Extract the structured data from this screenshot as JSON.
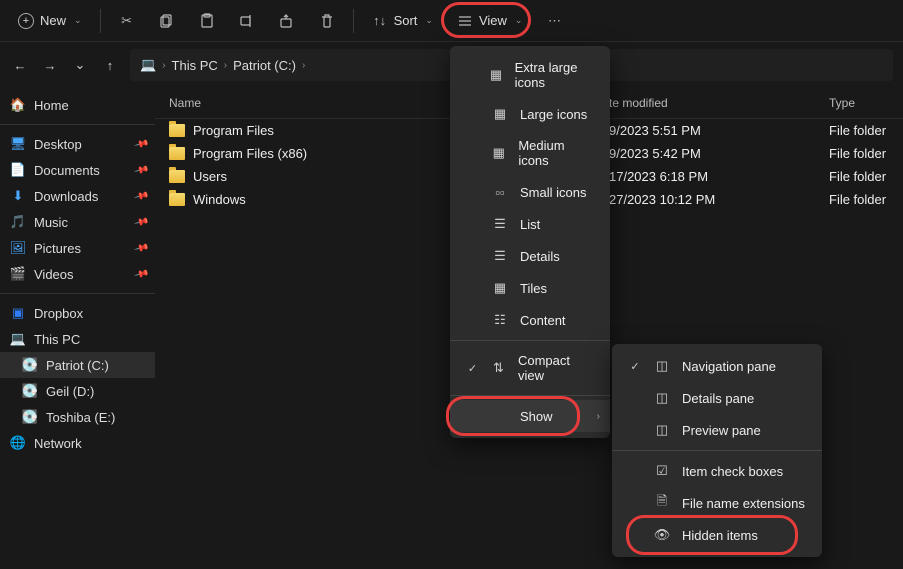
{
  "toolbar": {
    "new": "New",
    "sort": "Sort",
    "view": "View"
  },
  "breadcrumb": {
    "root": "This PC",
    "drive": "Patriot (C:)"
  },
  "sidebar": {
    "home": "Home",
    "quick": [
      {
        "label": "Desktop"
      },
      {
        "label": "Documents"
      },
      {
        "label": "Downloads"
      },
      {
        "label": "Music"
      },
      {
        "label": "Pictures"
      },
      {
        "label": "Videos"
      }
    ],
    "dropbox": "Dropbox",
    "thispc": "This PC",
    "drives": [
      {
        "label": "Patriot (C:)"
      },
      {
        "label": "Geil (D:)"
      },
      {
        "label": "Toshiba (E:)"
      }
    ],
    "network": "Network"
  },
  "columns": {
    "name": "Name",
    "date": "te modified",
    "type": "Type"
  },
  "files": [
    {
      "name": "Program Files",
      "date": "9/2023 5:51 PM",
      "type": "File folder"
    },
    {
      "name": "Program Files (x86)",
      "date": "9/2023 5:42 PM",
      "type": "File folder"
    },
    {
      "name": "Users",
      "date": "17/2023 6:18 PM",
      "type": "File folder"
    },
    {
      "name": "Windows",
      "date": "27/2023 10:12 PM",
      "type": "File folder"
    }
  ],
  "viewMenu": {
    "xl": "Extra large icons",
    "lg": "Large icons",
    "md": "Medium icons",
    "sm": "Small icons",
    "list": "List",
    "details": "Details",
    "tiles": "Tiles",
    "content": "Content",
    "compact": "Compact view",
    "show": "Show"
  },
  "showMenu": {
    "nav": "Navigation pane",
    "det": "Details pane",
    "prev": "Preview pane",
    "chk": "Item check boxes",
    "ext": "File name extensions",
    "hidden": "Hidden items"
  }
}
